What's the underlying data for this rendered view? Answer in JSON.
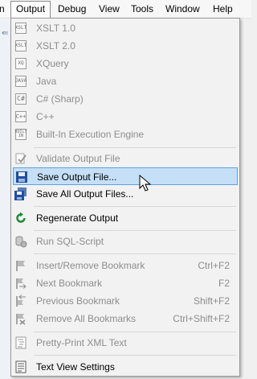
{
  "menubar": {
    "items": [
      {
        "label": "n"
      },
      {
        "label": "Output"
      },
      {
        "label": "Debug"
      },
      {
        "label": "View"
      },
      {
        "label": "Tools"
      },
      {
        "label": "Window"
      },
      {
        "label": "Help"
      }
    ]
  },
  "menu": {
    "items": [
      {
        "label": "XSLT 1.0",
        "icon_text": "XSLT",
        "icon": "xslt1-icon"
      },
      {
        "label": "XSLT 2.0",
        "icon_text": "XSLT",
        "icon": "xslt2-icon"
      },
      {
        "label": "XQuery",
        "icon_text": "XQ",
        "icon": "xquery-icon"
      },
      {
        "label": "Java",
        "icon_text": "JAVA",
        "icon": "java-icon"
      },
      {
        "label": "C# (Sharp)",
        "icon_text": "C#",
        "icon": "csharp-icon"
      },
      {
        "label": "C++",
        "icon_text": "C++",
        "icon": "cplusplus-icon"
      },
      {
        "label": "Built-In Execution Engine",
        "icon_text": "BUILT IN",
        "icon": "builtin-engine-icon"
      },
      {
        "label": "Validate Output File",
        "icon": "validate-icon"
      },
      {
        "label": "Save Output File...",
        "icon": "save-icon"
      },
      {
        "label": "Save All Output Files...",
        "icon": "save-all-icon"
      },
      {
        "label": "Regenerate Output",
        "icon": "regenerate-icon"
      },
      {
        "label": "Run SQL-Script",
        "icon": "sql-script-icon"
      },
      {
        "label": "Insert/Remove Bookmark",
        "shortcut": "Ctrl+F2",
        "icon": "bookmark-icon"
      },
      {
        "label": "Next Bookmark",
        "shortcut": "F2",
        "icon": "next-bookmark-icon"
      },
      {
        "label": "Previous Bookmark",
        "shortcut": "Shift+F2",
        "icon": "previous-bookmark-icon"
      },
      {
        "label": "Remove All Bookmarks",
        "shortcut": "Ctrl+Shift+F2",
        "icon": "remove-bookmarks-icon"
      },
      {
        "label": "Pretty-Print XML Text",
        "icon": "pretty-print-icon"
      },
      {
        "label": "Text View Settings",
        "icon": "text-view-settings-icon"
      }
    ]
  },
  "colors": {
    "highlight_bg": "#c5dff7",
    "highlight_border": "#5fa0df",
    "disabled_text": "#8d8d8d",
    "regenerate_green": "#1f8b3a",
    "save_blue": "#1f4fa0"
  }
}
